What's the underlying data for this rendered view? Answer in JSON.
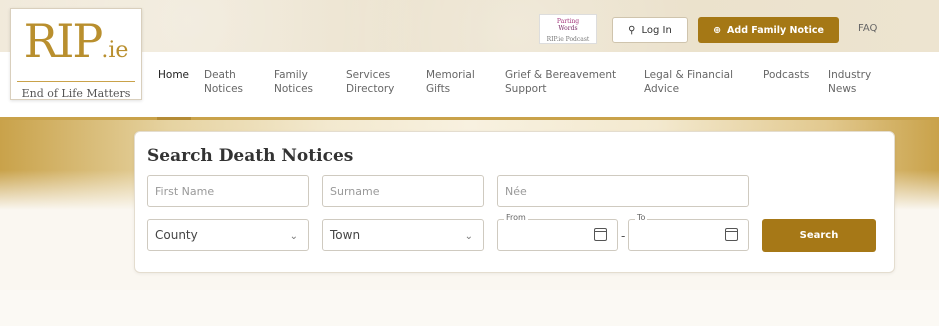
{
  "header": {
    "logo_mark": "RIP",
    "logo_suffix": ".ie",
    "logo_tagline": "End of Life Matters",
    "promo_lines": [
      "Parting",
      "Words",
      "RIP.ie Podcast"
    ],
    "login_label": "Log In",
    "add_notice_label": "Add Family Notice",
    "faq_label": "FAQ",
    "accent_color": "#a57815"
  },
  "nav": {
    "items": [
      {
        "label": "Home",
        "line2": ""
      },
      {
        "label": "Death",
        "line2": "Notices"
      },
      {
        "label": "Family",
        "line2": "Notices"
      },
      {
        "label": "Services",
        "line2": "Directory"
      },
      {
        "label": "Memorial",
        "line2": "Gifts"
      },
      {
        "label": "Grief & Bereavement",
        "line2": "Support"
      },
      {
        "label": "Legal & Financial",
        "line2": "Advice"
      },
      {
        "label": "Podcasts",
        "line2": ""
      },
      {
        "label": "Industry",
        "line2": "News"
      }
    ],
    "active": "Home"
  },
  "search": {
    "title": "Search Death Notices",
    "first_name_placeholder": "First Name",
    "surname_placeholder": "Surname",
    "nee_placeholder": "Née",
    "county_value": "County",
    "town_value": "Town",
    "from_label": "From",
    "to_label": "To",
    "date_separator": "-",
    "search_label": "Search"
  }
}
